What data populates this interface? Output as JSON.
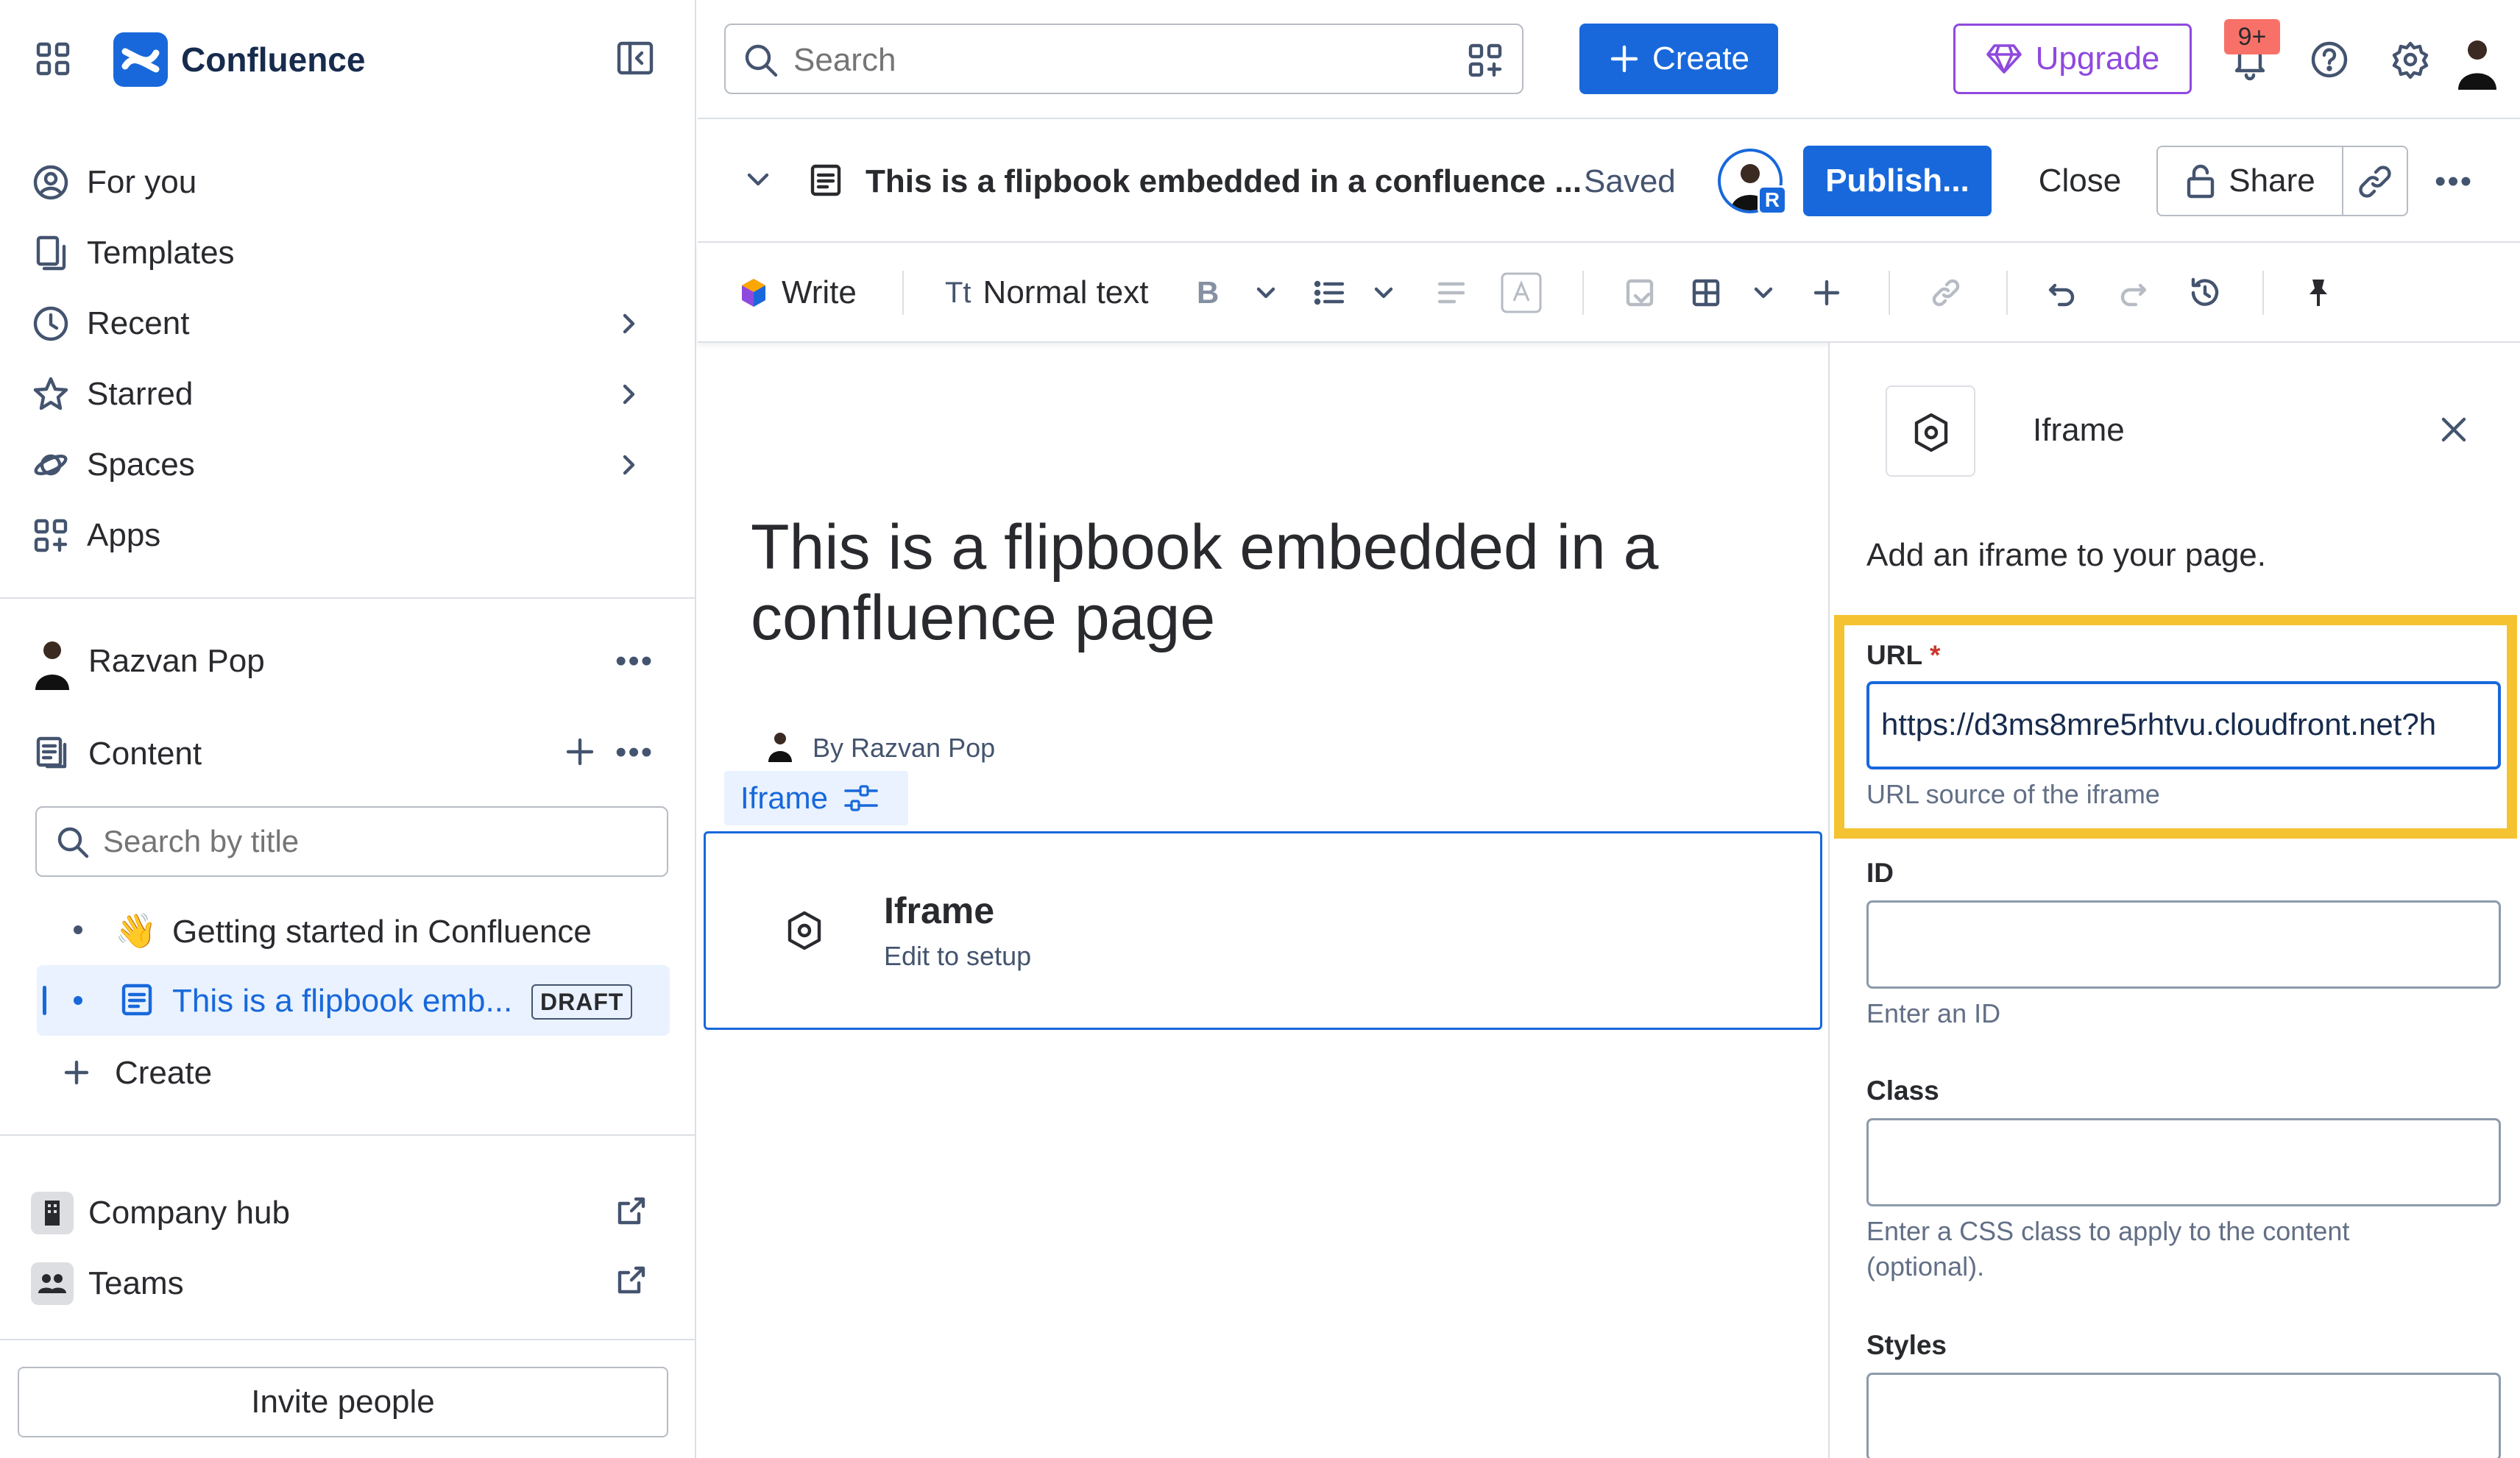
{
  "app": {
    "name": "Confluence"
  },
  "sidebar": {
    "nav": [
      {
        "label": "For you"
      },
      {
        "label": "Templates"
      },
      {
        "label": "Recent"
      },
      {
        "label": "Starred"
      },
      {
        "label": "Spaces"
      },
      {
        "label": "Apps"
      }
    ],
    "space": {
      "name": "Razvan Pop"
    },
    "content": {
      "label": "Content",
      "search_placeholder": "Search by title"
    },
    "tree": [
      {
        "emoji": "👋",
        "label": "Getting started in Confluence"
      },
      {
        "label": "This is a flipbook emb...",
        "badge": "DRAFT"
      }
    ],
    "create_label": "Create",
    "footer": [
      {
        "label": "Company hub"
      },
      {
        "label": "Teams"
      }
    ],
    "invite_label": "Invite people"
  },
  "topbar": {
    "search_placeholder": "Search",
    "create_label": "Create",
    "upgrade_label": "Upgrade",
    "notification_badge": "9+"
  },
  "pagebar": {
    "title": "This is a flipbook embedded in a confluence ...",
    "status": "Saved",
    "avatar_badge": "R",
    "publish_label": "Publish...",
    "close_label": "Close",
    "share_label": "Share"
  },
  "toolbar": {
    "write_label": "Write",
    "text_style": "Normal text",
    "tt": "Tt",
    "bold": "B"
  },
  "editor": {
    "title": "This is a flipbook embedded in a confluence page",
    "byline": "By Razvan Pop",
    "macro_tag": "Iframe",
    "macro_title": "Iframe",
    "macro_subtitle": "Edit to setup"
  },
  "panel": {
    "title": "Iframe",
    "description": "Add an iframe to your page.",
    "url": {
      "label": "URL",
      "required": "*",
      "value": "https://d3ms8mre5rhtvu.cloudfront.net?h",
      "help": "URL source of the iframe"
    },
    "id": {
      "label": "ID",
      "value": "",
      "help": "Enter an ID"
    },
    "class": {
      "label": "Class",
      "value": "",
      "help": "Enter a CSS class to apply to the content (optional)."
    },
    "styles": {
      "label": "Styles",
      "value": ""
    }
  },
  "colors": {
    "brand": "#1868db",
    "highlight": "#f5c331",
    "upgrade": "#8f49de",
    "badge": "#f87168"
  }
}
